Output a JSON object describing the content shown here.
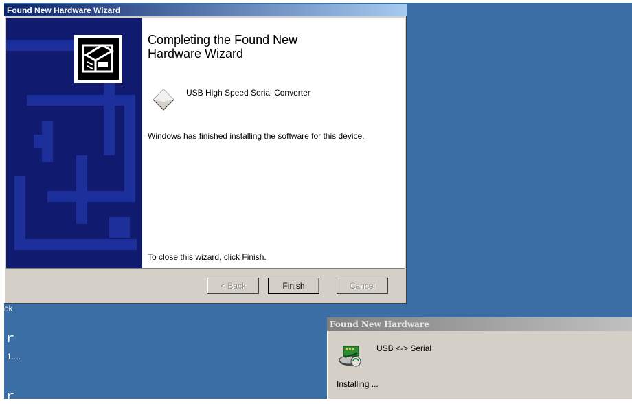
{
  "wizard": {
    "title": "Found New Hardware Wizard",
    "heading": "Completing the Found New Hardware Wizard",
    "device_name": "USB High Speed Serial Converter",
    "finished_text": "Windows has finished installing the software for this device.",
    "close_text": "To close this wizard, click Finish.",
    "buttons": {
      "back": "< Back",
      "finish": "Finish",
      "cancel": "Cancel"
    }
  },
  "balloon": {
    "title": "Found New Hardware",
    "device": "USB <-> Serial",
    "status": "Installing ..."
  },
  "desktop": {
    "fragments": [
      "ok",
      "1...."
    ]
  },
  "colors": {
    "desktop": "#3a6ea5",
    "titlebar_active_start": "#0a246a",
    "titlebar_active_end": "#a6caf0",
    "face": "#d4d0c8",
    "wizard_side": "#101a6e"
  },
  "icons": {
    "wizard_hardware": "hardware-install-icon",
    "device": "generic-device-icon",
    "balloon": "hardware-install-icon"
  }
}
